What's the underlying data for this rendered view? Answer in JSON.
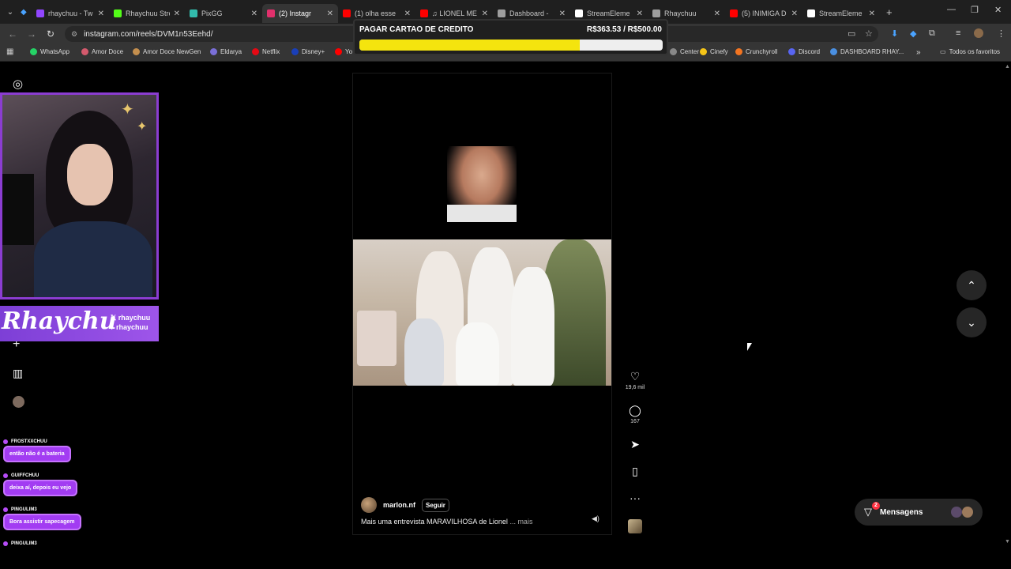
{
  "browser": {
    "tabs": [
      {
        "label": "rhaychuu - Tw",
        "color": "#9146ff",
        "active": false
      },
      {
        "label": "Rhaychuu Stre",
        "color": "#53fc18",
        "active": false
      },
      {
        "label": "PixGG",
        "color": "#32bcad",
        "active": false
      },
      {
        "label": "(2) Instagr",
        "color": "#e1306c",
        "active": true
      },
      {
        "label": "(1) olha esse",
        "color": "#ff0000",
        "active": false
      },
      {
        "label": "♫ LIONEL ME",
        "color": "#ff0000",
        "active": false
      },
      {
        "label": "Dashboard - ",
        "color": "#9e9e9e",
        "active": false
      },
      {
        "label": "StreamEleme",
        "color": "#ffffff",
        "active": false
      },
      {
        "label": "Rhaychuu",
        "color": "#9e9e9e",
        "active": false
      },
      {
        "label": "(5) INIMIGA D",
        "color": "#ff0000",
        "active": false
      },
      {
        "label": "StreamEleme",
        "color": "#ffffff",
        "active": false
      }
    ],
    "url": "instagram.com/reels/DVM1n53Eehd/",
    "bookmarks_all": "Todos os favoritos",
    "bookmarks": [
      {
        "label": "WhatsApp",
        "color": "#25d366"
      },
      {
        "label": "Amor Doce",
        "color": "#d45a6d"
      },
      {
        "label": "Amor Doce NewGen",
        "color": "#c48f4e"
      },
      {
        "label": "Eldarya",
        "color": "#7a6fd8"
      },
      {
        "label": "Netflix",
        "color": "#e50914"
      },
      {
        "label": "Disney+",
        "color": "#1a3fb8"
      },
      {
        "label": "Yo",
        "color": "#ff0000"
      },
      {
        "label": "Center",
        "color": "#888888"
      },
      {
        "label": "Cinefy",
        "color": "#f5c518"
      },
      {
        "label": "Crunchyroll",
        "color": "#f47521"
      },
      {
        "label": "Discord",
        "color": "#5865f2"
      },
      {
        "label": "DASHBOARD RHAY...",
        "color": "#4a90e2"
      }
    ]
  },
  "goal": {
    "title": "PAGAR CARTAO DE CREDITO",
    "value_label": "R$363.53 / R$500.00",
    "progress": 0.727,
    "fill_color": "#f4e40e"
  },
  "overlay": {
    "brand_name": "Rhaychu",
    "handle_x": "rhaychuu",
    "handle_tiktok": "rhaychuu"
  },
  "chat": [
    {
      "user": "FROSTXXCHUU",
      "message": "então não é a bateria"
    },
    {
      "user": "GUIFFCHUU",
      "message": "deixa aí, depois eu vejo"
    },
    {
      "user": "PINGULIM3",
      "message": "Bora assistir sapecagem"
    },
    {
      "user": "PINGULIM3",
      "message": ""
    }
  ],
  "reel": {
    "username": "marlon.nf",
    "follow_label": "Seguir",
    "caption": "Mais uma entrevista MARAVILHOSA de Lionel",
    "caption_more": "... mais",
    "likes": "19,6 mil",
    "comments": "167"
  },
  "messages": {
    "label": "Mensagens",
    "count": "2"
  },
  "icons": {
    "instagram": "instagram-icon",
    "like": "heart-icon",
    "comment": "comment-icon",
    "share": "share-icon",
    "save": "bookmark-icon",
    "more": "more-icon"
  }
}
